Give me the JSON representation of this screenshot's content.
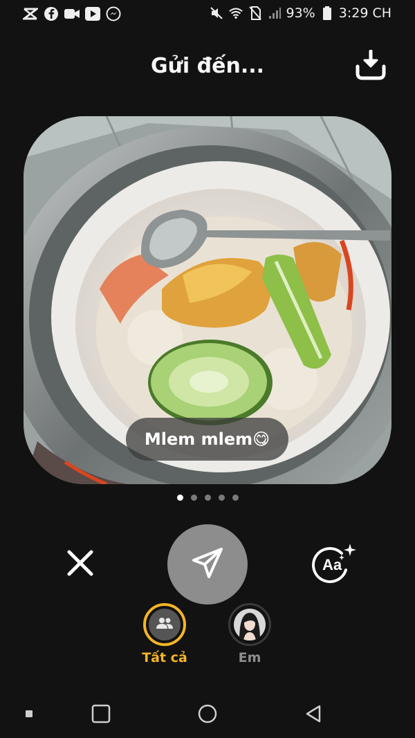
{
  "status_bar": {
    "battery": "93%",
    "time": "3:29 CH",
    "left_icons": [
      "capcut-icon",
      "facebook-icon",
      "video-call-icon",
      "youtube-icon",
      "messenger-icon"
    ],
    "right_icons": [
      "mute-icon",
      "wifi-icon",
      "no-sim-icon",
      "signal-icon",
      "battery-icon"
    ]
  },
  "header": {
    "title": "Gửi đến...",
    "download_icon": "download-icon"
  },
  "photo": {
    "caption": "Mlem mlem😋",
    "pages": 5,
    "active_page": 1
  },
  "actions": {
    "close_icon": "close-icon",
    "send_icon": "send-icon",
    "text_style_icon": "text-style-icon",
    "text_style_glyph": "Aa"
  },
  "recipients": [
    {
      "label": "Tất cả",
      "selected": true,
      "icon": "group-icon"
    },
    {
      "label": "Em",
      "selected": false,
      "icon": "avatar"
    }
  ],
  "nav": {
    "items": [
      "menu-icon",
      "recents-icon",
      "home-icon",
      "back-icon"
    ]
  },
  "colors": {
    "background": "#121212",
    "accent": "#f5b526",
    "send_button": "#8d8d8d",
    "inactive_label": "#8e8e8e"
  }
}
